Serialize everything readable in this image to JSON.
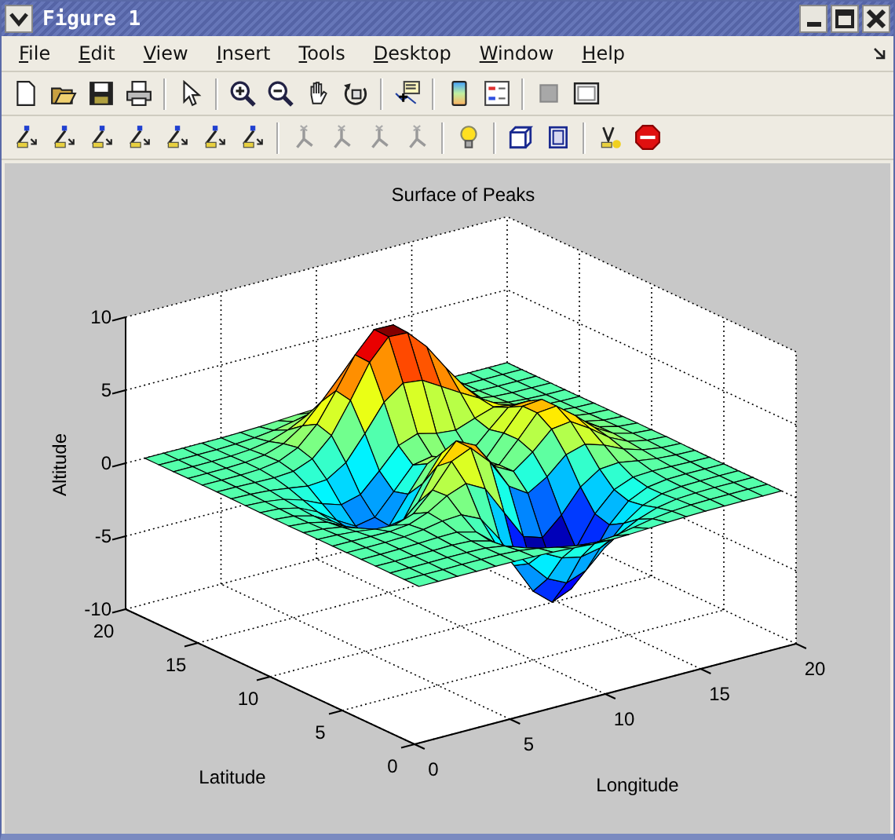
{
  "window": {
    "title": "Figure 1"
  },
  "menu": [
    {
      "label": "File"
    },
    {
      "label": "Edit"
    },
    {
      "label": "View"
    },
    {
      "label": "Insert"
    },
    {
      "label": "Tools"
    },
    {
      "label": "Desktop"
    },
    {
      "label": "Window"
    },
    {
      "label": "Help"
    }
  ],
  "plot": {
    "title": "Surface of Peaks",
    "xlabel": "Longitude",
    "ylabel": "Latitude",
    "zlabel": "Altitude",
    "xticks": [
      "0",
      "5",
      "10",
      "15",
      "20"
    ],
    "yticks": [
      "0",
      "5",
      "10",
      "15",
      "20"
    ],
    "zticks": [
      "10",
      "5",
      "0",
      "-5",
      "-10"
    ]
  }
}
